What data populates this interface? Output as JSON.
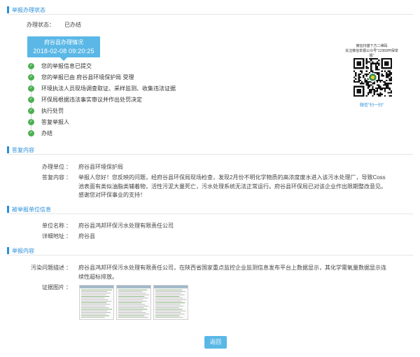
{
  "status_section": {
    "title": "举报办理状态",
    "status_label": "办理状态：",
    "status_value": "已办结",
    "badge_title": "府谷县办理情况",
    "badge_datetime": "2018-02-08 09:20:25",
    "steps": [
      "您的举报信息已提交",
      "您的举报已由 府谷县环境保护局 受理",
      "环境执法人员现场调查取证、采样监测、收集违法证据",
      "环保局根据违法事实审议并作出处罚决定",
      "执行处罚",
      "答复举报人",
      "办结"
    ],
    "step_icon": "check-circle-icon"
  },
  "qr": {
    "caption_line1": "微信扫描下方二维码",
    "caption_line2": "关注微信举报公众号\"12369环保举报\"",
    "link_text": "微信\"扫一扫\"",
    "icon": "qr-code-icon"
  },
  "reply_section": {
    "title": "答复内容",
    "unit_label": "办理单位",
    "unit_value": "府谷县环境保护局",
    "content_label": "答复内容",
    "content_value": "举报人您好！您反映的问题，经府谷县环保局现场检查，发现2月份不明化学物质的高浓度废水进入该污水处理厂，导致Coss池表面有类似油脂类辅着物，活性污泥大量死亡，污水处理系统无法正常运行。府谷县环保局已对该企业作出限期整改意见。感谢您对环保事业的支持！"
  },
  "reported_section": {
    "title": "被举报单位信息",
    "name_label": "单位名称",
    "name_value": "府谷县鸿邦环保污水处理有限责任公司",
    "address_label": "详细地址",
    "address_value": "府谷县"
  },
  "report_section": {
    "title": "举报内容",
    "problem_label": "污染问题描述",
    "problem_value": "府谷县鸿邦环保污水处理有限责任公司，在陕西省国家重点监控企业监测信息发布平台上数据显示，其化学需氧量数据显示连续性超标排放。",
    "evidence_label": "证据图片"
  },
  "colon": "：",
  "back_button": "返回",
  "accent_color": "#2a8fd8",
  "badge_color": "#5bb8e6",
  "check_color": "#4caf50"
}
